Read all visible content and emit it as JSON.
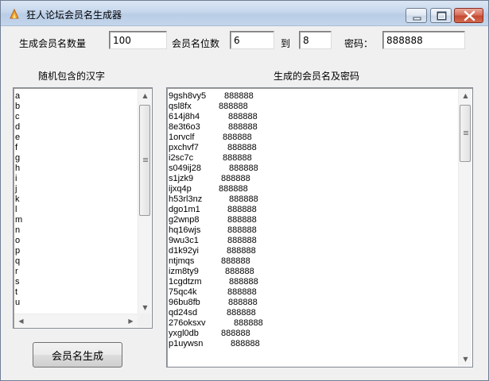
{
  "window": {
    "title": "狂人论坛会员名生成器"
  },
  "labels": {
    "count": "生成会员名数量",
    "digits": "会员名位数",
    "to": "到",
    "password": "密码：",
    "chars_header": "随机包含的汉字",
    "results_header": "生成的会员名及密码"
  },
  "inputs": {
    "count": "100",
    "digits_min": "6",
    "digits_max": "8",
    "password": "888888"
  },
  "char_list": [
    "a",
    "b",
    "c",
    "d",
    "e",
    "f",
    "g",
    "h",
    "i",
    "j",
    "k",
    "l",
    "m",
    "n",
    "o",
    "p",
    "q",
    "r",
    "s",
    "t",
    "u"
  ],
  "results": [
    {
      "name": "9gsh8vy5",
      "pw": "888888",
      "pad": 70
    },
    {
      "name": "qsl8fx",
      "pw": "888888",
      "pad": 63
    },
    {
      "name": "614j8h4",
      "pw": "888888",
      "pad": 75
    },
    {
      "name": "8e3t6o3",
      "pw": "888888",
      "pad": 75
    },
    {
      "name": "1orvclf",
      "pw": "888888",
      "pad": 68
    },
    {
      "name": "pxchvf7",
      "pw": "888888",
      "pad": 74
    },
    {
      "name": "i2sc7c",
      "pw": "888888",
      "pad": 68
    },
    {
      "name": "s049ij28",
      "pw": "888888",
      "pad": 76
    },
    {
      "name": "s1jzk9",
      "pw": "888888",
      "pad": 66
    },
    {
      "name": "ijxq4p",
      "pw": "888888",
      "pad": 63
    },
    {
      "name": "h53rl3nz",
      "pw": "888888",
      "pad": 76
    },
    {
      "name": "dgo1m1",
      "pw": "888888",
      "pad": 74
    },
    {
      "name": "g2wnp8",
      "pw": "888888",
      "pad": 74
    },
    {
      "name": "hq16wjs",
      "pw": "888888",
      "pad": 74
    },
    {
      "name": "9wu3c1",
      "pw": "888888",
      "pad": 74
    },
    {
      "name": "d1k92yi",
      "pw": "888888",
      "pad": 73
    },
    {
      "name": "ntjmqs",
      "pw": "888888",
      "pad": 66
    },
    {
      "name": "izm8ty9",
      "pw": "888888",
      "pad": 71
    },
    {
      "name": "1cgdtzm",
      "pw": "888888",
      "pad": 76
    },
    {
      "name": "75qc4k",
      "pw": "888888",
      "pad": 74
    },
    {
      "name": "96bu8fb",
      "pw": "888888",
      "pad": 75
    },
    {
      "name": "qd24sd",
      "pw": "888888",
      "pad": 73
    },
    {
      "name": "276oksxv",
      "pw": "888888",
      "pad": 82
    },
    {
      "name": "yxgl0db",
      "pw": "888888",
      "pad": 66
    },
    {
      "name": "p1uywsn",
      "pw": "888888",
      "pad": 78
    }
  ],
  "buttons": {
    "generate": "会员名生成"
  }
}
